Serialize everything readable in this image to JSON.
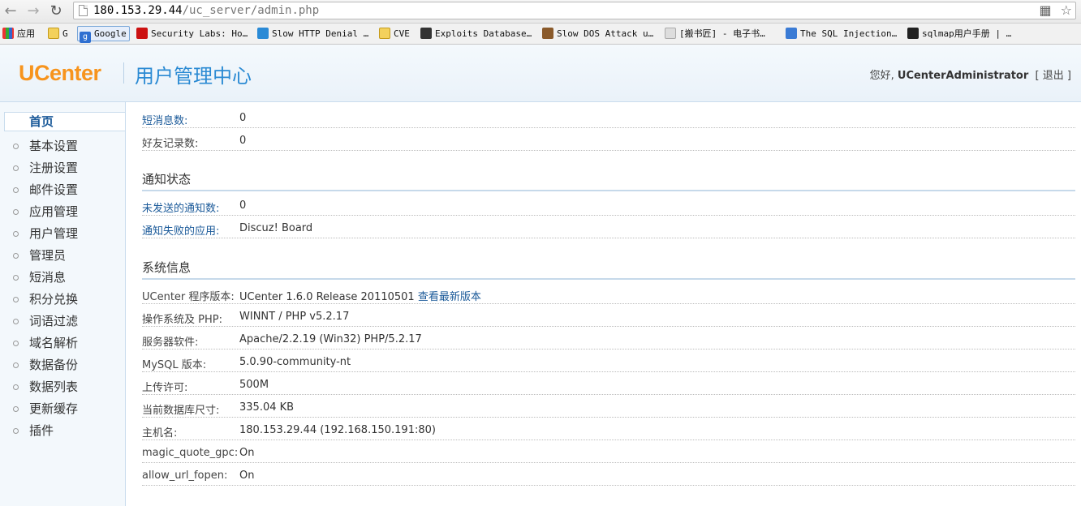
{
  "browser": {
    "url_host": "180.153.29.44",
    "url_path": "/uc_server/admin.php",
    "bookmarks": [
      {
        "label": "应用",
        "icon": "apps-grid-icon"
      },
      {
        "label": "G",
        "icon": "folder-icon"
      },
      {
        "label": "Google",
        "icon": "google-icon"
      },
      {
        "label": "Security Labs: Ho…",
        "icon": "shield-icon"
      },
      {
        "label": "Slow HTTP Denial …",
        "icon": "blue-square-icon"
      },
      {
        "label": "CVE",
        "icon": "folder-icon"
      },
      {
        "label": "Exploits Database…",
        "icon": "exploit-db-icon"
      },
      {
        "label": "Slow DOS Attack u…",
        "icon": "tan-square-icon"
      },
      {
        "label": "[搬书匠] - 电子书…",
        "icon": "page-icon"
      },
      {
        "label": "The SQL Injection…",
        "icon": "pencil-icon"
      },
      {
        "label": "sqlmap用户手册 | …",
        "icon": "terminal-icon"
      }
    ]
  },
  "header": {
    "logo": "UCenter",
    "title": "用户管理中心",
    "greeting_prefix": "您好,",
    "username": "UCenterAdministrator",
    "logout_open": "[",
    "logout": "退出",
    "logout_close": "]"
  },
  "sidebar": {
    "items": [
      {
        "label": "首页",
        "active": true
      },
      {
        "label": "基本设置"
      },
      {
        "label": "注册设置"
      },
      {
        "label": "邮件设置"
      },
      {
        "label": "应用管理"
      },
      {
        "label": "用户管理"
      },
      {
        "label": "管理员"
      },
      {
        "label": "短消息"
      },
      {
        "label": "积分兑换"
      },
      {
        "label": "词语过滤"
      },
      {
        "label": "域名解析"
      },
      {
        "label": "数据备份"
      },
      {
        "label": "数据列表"
      },
      {
        "label": "更新缓存"
      },
      {
        "label": "插件"
      }
    ]
  },
  "stats": [
    {
      "key": "短消息数:",
      "value": "0"
    },
    {
      "key": "好友记录数:",
      "value": "0"
    }
  ],
  "notice": {
    "title": "通知状态",
    "rows": [
      {
        "key": "未发送的通知数:",
        "value": "0"
      },
      {
        "key": "通知失败的应用:",
        "value": "Discuz! Board"
      }
    ]
  },
  "sysinfo": {
    "title": "系统信息",
    "version_key": "UCenter 程序版本:",
    "version_value": "UCenter 1.6.0 Release 20110501",
    "version_link": "查看最新版本",
    "rows": [
      {
        "key": "操作系统及 PHP:",
        "value": "WINNT / PHP v5.2.17"
      },
      {
        "key": "服务器软件:",
        "value": "Apache/2.2.19 (Win32) PHP/5.2.17"
      },
      {
        "key": "MySQL 版本:",
        "value": "5.0.90-community-nt"
      },
      {
        "key": "上传许可:",
        "value": "500M"
      },
      {
        "key": "当前数据库尺寸:",
        "value": "335.04 KB"
      },
      {
        "key": "主机名:",
        "value": "180.153.29.44 (192.168.150.191:80)"
      },
      {
        "key": "magic_quote_gpc:",
        "value": "On"
      },
      {
        "key": "allow_url_fopen:",
        "value": "On"
      }
    ]
  }
}
